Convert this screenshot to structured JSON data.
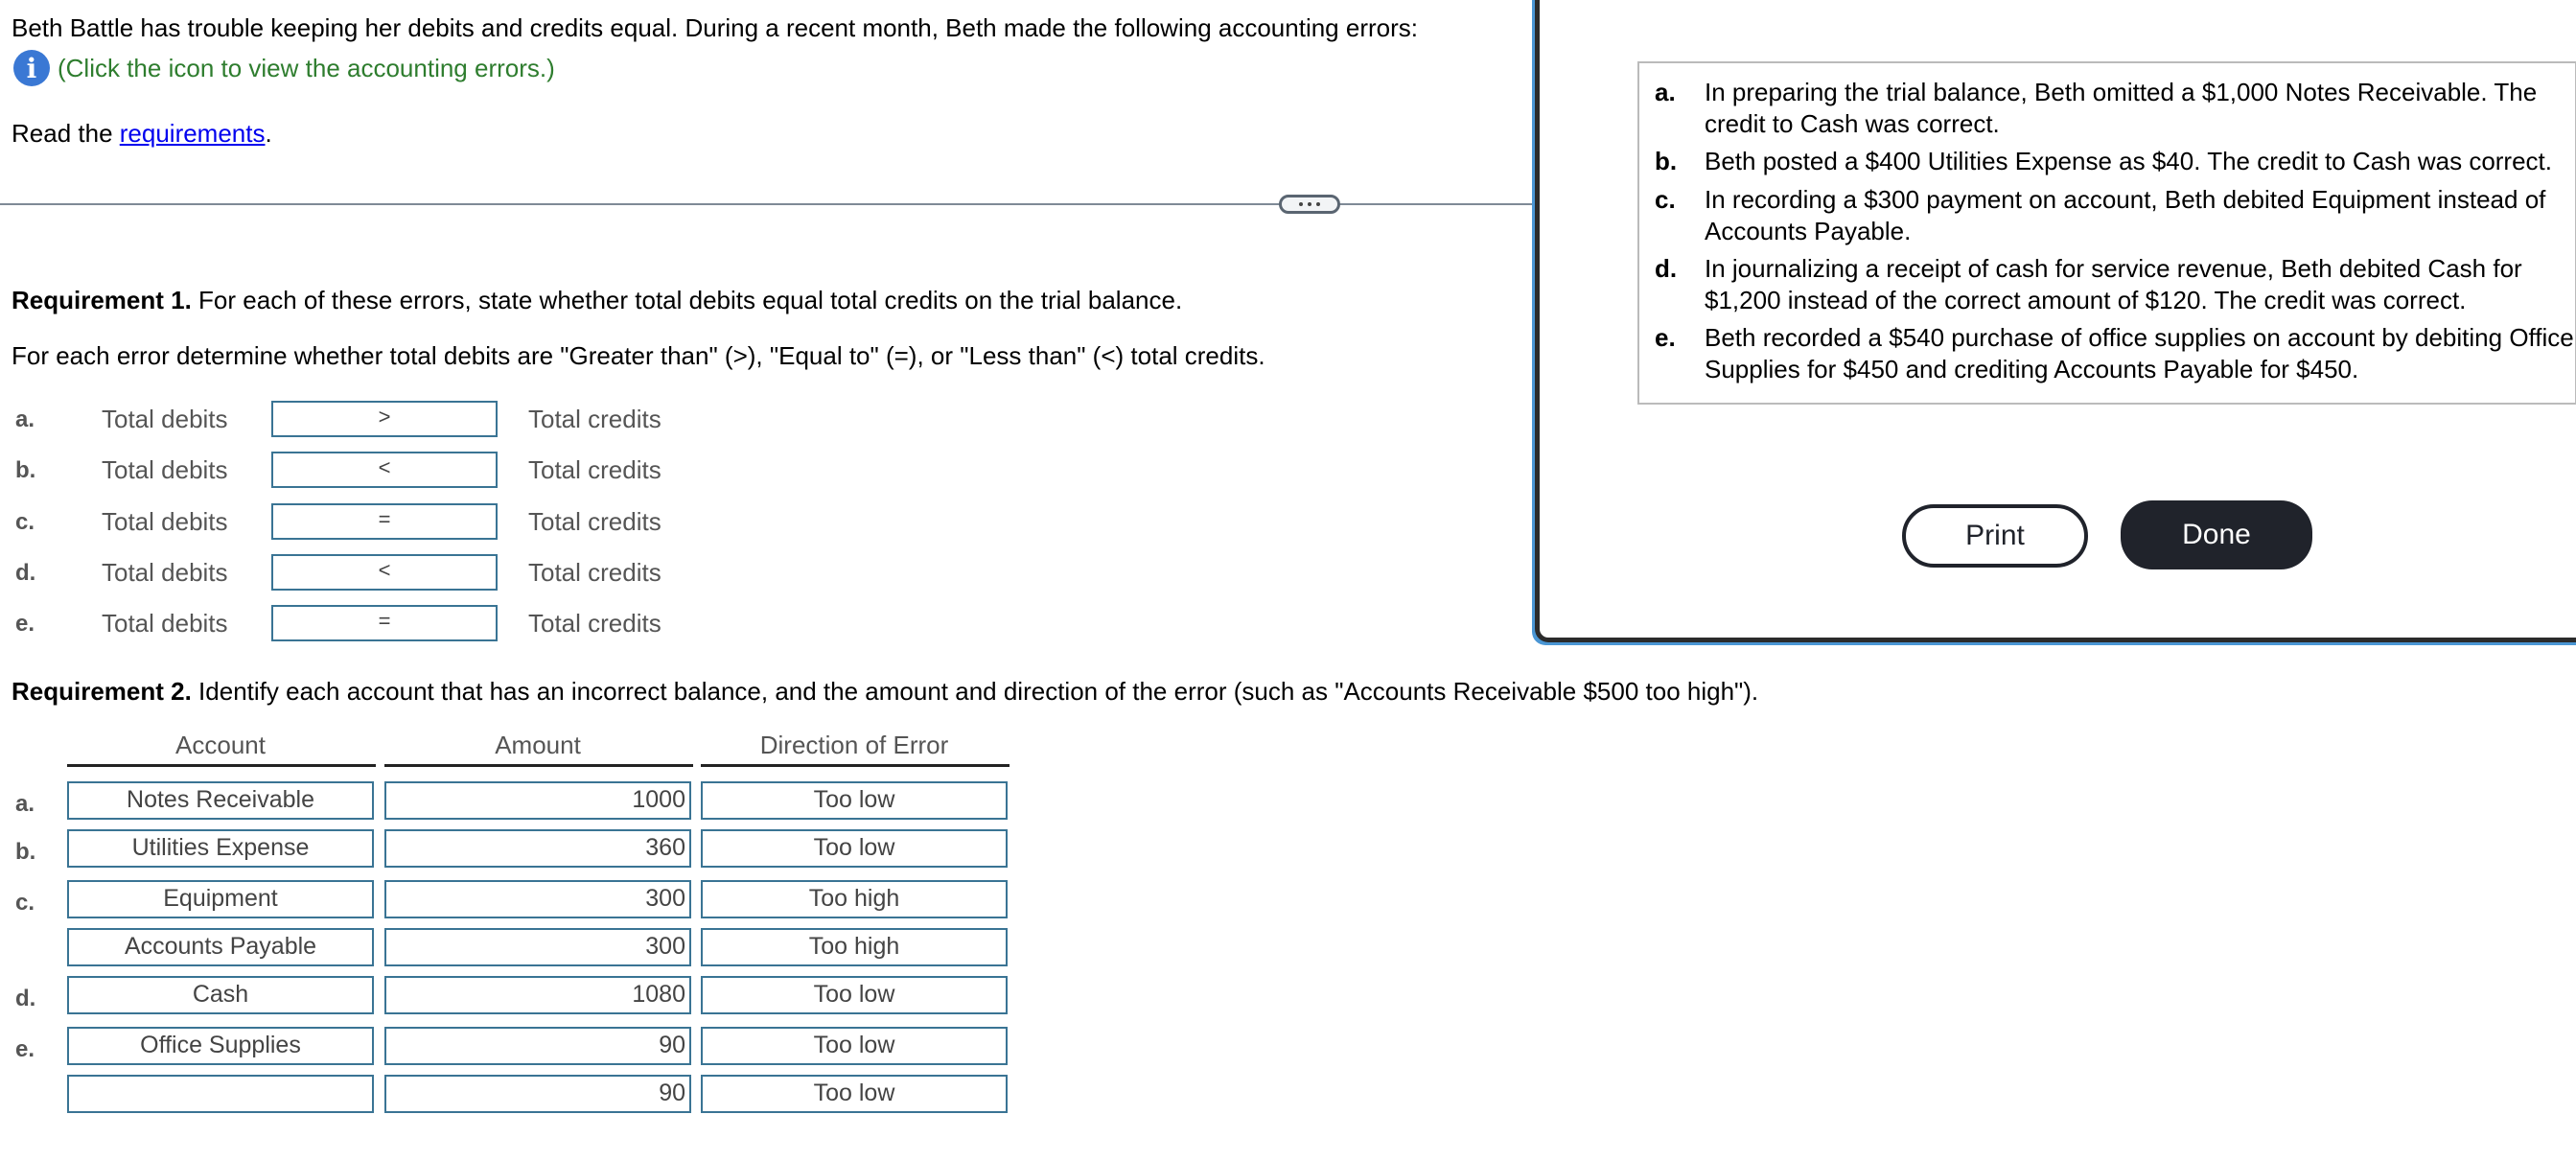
{
  "intro": {
    "text": "Beth Battle has trouble keeping her debits and credits equal. During a recent month, Beth made the following accounting errors:",
    "info_icon": "info-icon",
    "info_text": "(Click the icon to view the accounting errors.)",
    "read_prefix": "Read the ",
    "requirements_link": "requirements",
    "read_suffix": "."
  },
  "divider": {
    "handle_icon": "more-dots-icon"
  },
  "requirement1": {
    "title": "Requirement 1.",
    "text": " For each of these errors, state whether total debits equal total credits on the trial balance.",
    "instruction": "For each error determine whether total debits are \"Greater than\" (>), \"Equal to\" (=), or \"Less than\" (<) total credits.",
    "rows": [
      {
        "letter": "a.",
        "left": "Total debits",
        "value": ">",
        "right": "Total credits"
      },
      {
        "letter": "b.",
        "left": "Total debits",
        "value": "<",
        "right": "Total credits"
      },
      {
        "letter": "c.",
        "left": "Total debits",
        "value": "=",
        "right": "Total credits"
      },
      {
        "letter": "d.",
        "left": "Total debits",
        "value": "<",
        "right": "Total credits"
      },
      {
        "letter": "e.",
        "left": "Total debits",
        "value": "=",
        "right": "Total credits"
      }
    ]
  },
  "requirement2": {
    "title": "Requirement 2.",
    "text": " Identify each account that has an incorrect balance, and the amount and direction of the error (such as \"Accounts Receivable $500 too high\").",
    "columns": [
      "Account",
      "Amount",
      "Direction of Error"
    ],
    "rows": [
      {
        "letter": "a.",
        "account": "Notes Receivable",
        "amount": "1000",
        "direction": "Too low"
      },
      {
        "letter": "b.",
        "account": "Utilities Expense",
        "amount": "360",
        "direction": "Too low"
      },
      {
        "letter": "c.",
        "account": "Equipment",
        "amount": "300",
        "direction": "Too high"
      },
      {
        "letter": "",
        "account": "Accounts Payable",
        "amount": "300",
        "direction": "Too high"
      },
      {
        "letter": "d.",
        "account": "Cash",
        "amount": "1080",
        "direction": "Too low"
      },
      {
        "letter": "e.",
        "account": "Office Supplies",
        "amount": "90",
        "direction": "Too low"
      },
      {
        "letter": "",
        "account": "",
        "amount": "90",
        "direction": "Too low"
      }
    ]
  },
  "popup": {
    "errors": [
      {
        "letter": "a.",
        "text": "In preparing the trial balance, Beth omitted a $1,000 Notes Receivable. The credit to Cash was correct."
      },
      {
        "letter": "b.",
        "text": "Beth posted a $400 Utilities Expense as $40. The credit to Cash was correct."
      },
      {
        "letter": "c.",
        "text": "In recording a $300 payment on account, Beth debited Equipment instead of Accounts Payable."
      },
      {
        "letter": "d.",
        "text": "In journalizing a receipt of cash for service revenue, Beth debited Cash for $1,200 instead of the correct amount of $120. The credit was correct."
      },
      {
        "letter": "e.",
        "text": "Beth recorded a $540 purchase of office supplies on account by debiting Office Supplies for $450 and crediting Accounts Payable for $450."
      }
    ],
    "print_label": "Print",
    "done_label": "Done"
  },
  "colors": {
    "info_green": "#2e7d2e",
    "link_blue": "#0000ee",
    "input_border": "#3a7494",
    "button_dark": "#20232b",
    "popup_accent": "#4a96d4"
  }
}
